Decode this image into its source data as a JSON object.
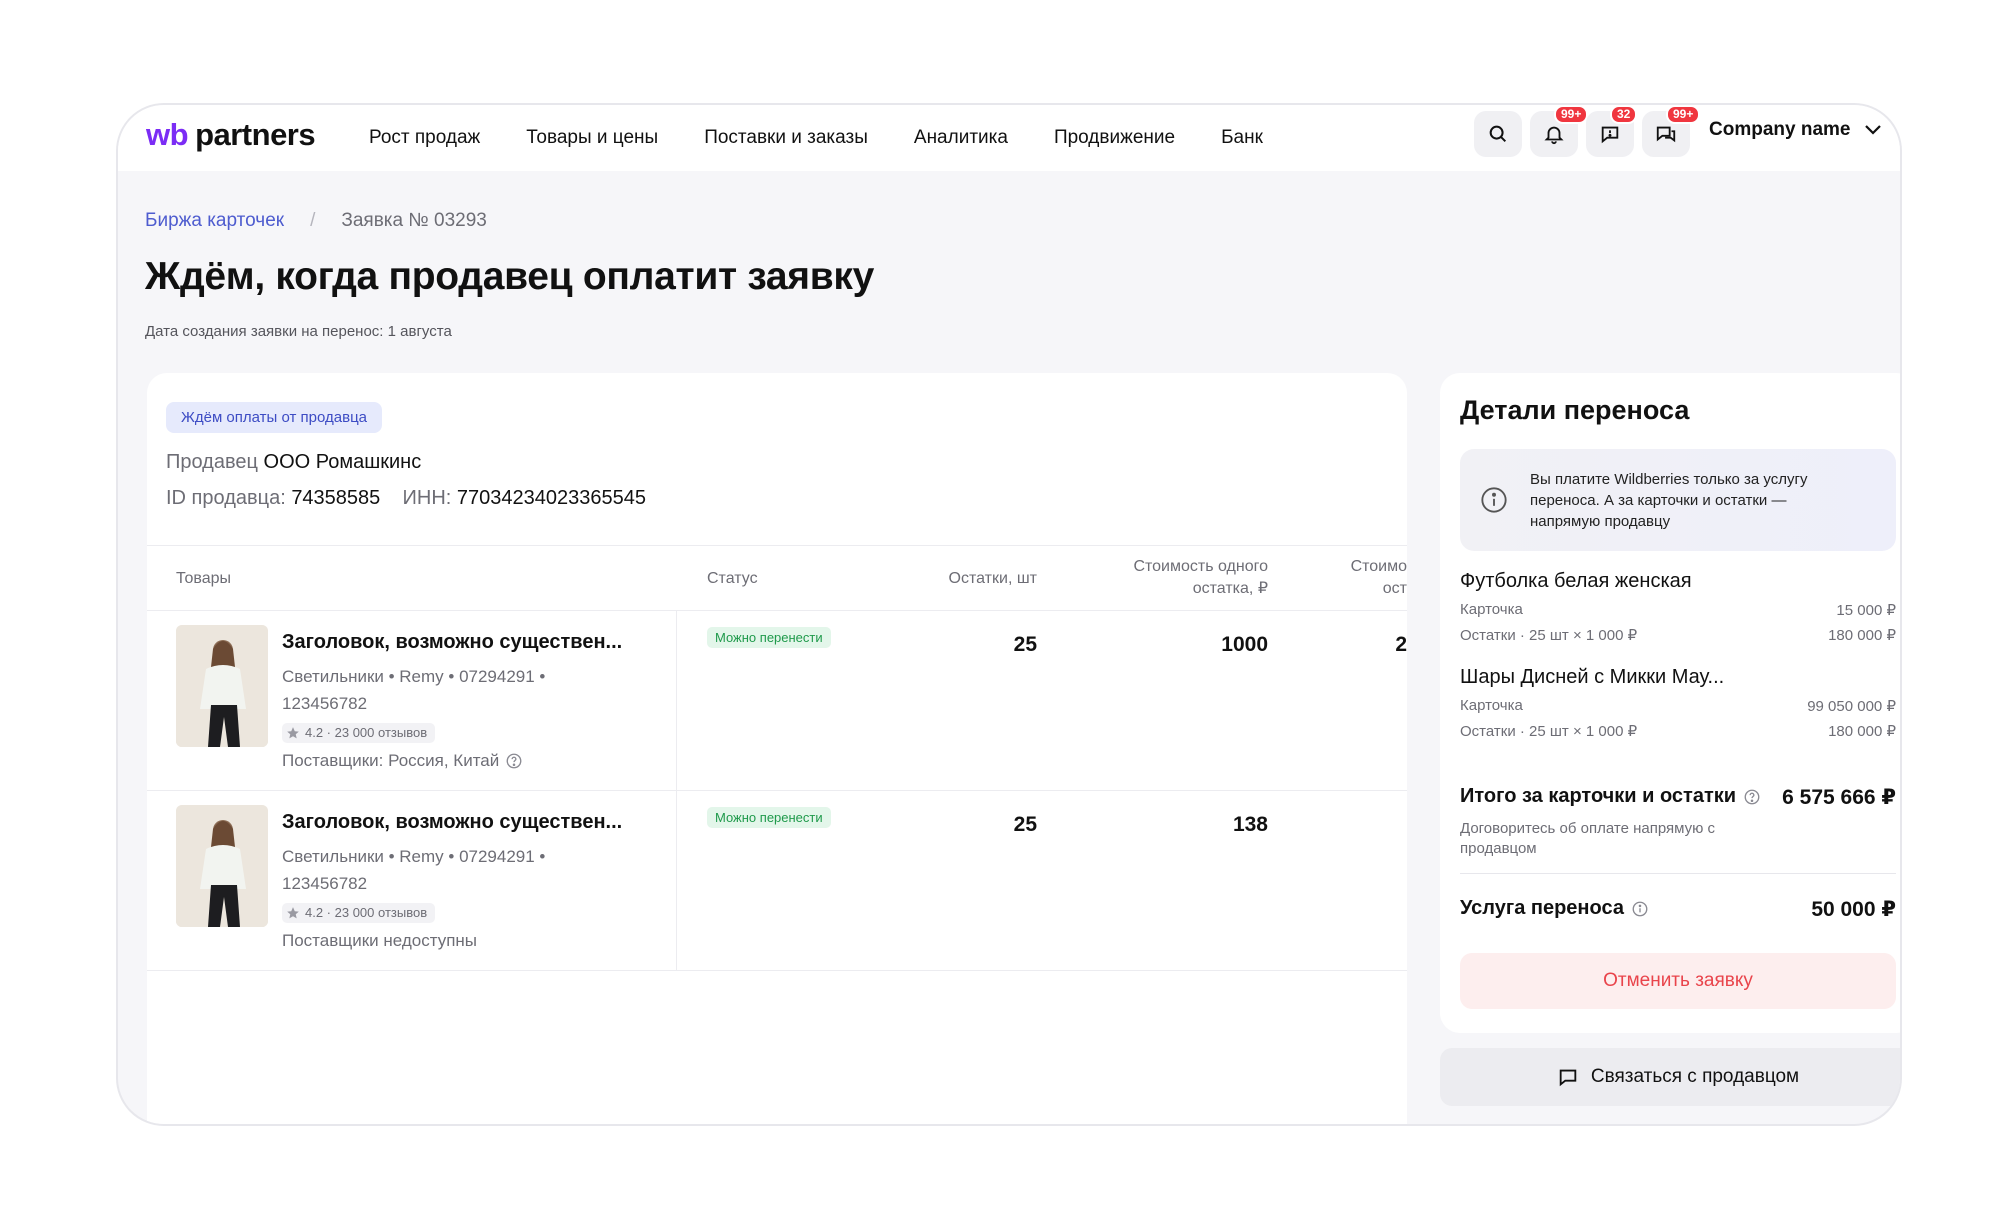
{
  "header": {
    "logo_wb": "wb",
    "logo_partners": "partners",
    "nav": [
      "Рост продаж",
      "Товары и цены",
      "Поставки и заказы",
      "Аналитика",
      "Продвижение",
      "Банк"
    ],
    "badges": {
      "notifications": "99+",
      "chat": "32",
      "messages": "99+"
    },
    "company": "Company name"
  },
  "breadcrumb": {
    "parent": "Биржа карточек",
    "separator": "/",
    "current": "Заявка № 03293"
  },
  "page": {
    "title": "Ждём, когда продавец оплатит заявку",
    "subtitle": "Дата создания заявки на перенос: 1 августа"
  },
  "request": {
    "status": "Ждём оплаты от продавца",
    "seller_label": "Продавец",
    "seller_name": "ООО Ромашкинс",
    "id_label": "ID продавца:",
    "id_value": "74358585",
    "inn_label": "ИНН:",
    "inn_value": "77034234023365545"
  },
  "table": {
    "headers": {
      "goods": "Товары",
      "status": "Статус",
      "stock": "Остатки, шт",
      "unit_cost_1": "Стоимость одного",
      "unit_cost_2": "остатка, ₽",
      "total_cost_1": "Стоимо",
      "total_cost_2": "ост"
    },
    "rows": [
      {
        "title": "Заголовок, возможно существен...",
        "meta_1": "Светильники • Remy • 07294291 •",
        "meta_2": "123456782",
        "rating": "4.2 · 23 000 отзывов",
        "suppliers": "Поставщики: Россия, Китай",
        "status": "Можно перенести",
        "stock": "25",
        "unit_cost": "1000",
        "total_partial": "2"
      },
      {
        "title": "Заголовок, возможно существен...",
        "meta_1": "Светильники • Remy • 07294291 •",
        "meta_2": "123456782",
        "rating": "4.2 · 23 000 отзывов",
        "suppliers": "Поставщики недоступны",
        "status": "Можно перенести",
        "stock": "25",
        "unit_cost": "138",
        "total_partial": ""
      }
    ]
  },
  "details": {
    "title": "Детали переноса",
    "info": "Вы платите Wildberries только за услугу переноса. А за карточки и остатки — напрямую продавцу",
    "items": [
      {
        "name": "Футболка белая женская",
        "card_label": "Карточка",
        "card_value": "15 000 ₽",
        "stock_label": "Остатки · 25 шт × 1 000 ₽",
        "stock_value": "180 000 ₽"
      },
      {
        "name": "Шары Диснeй с Микки Мау...",
        "card_label": "Карточка",
        "card_value": "99 050 000 ₽",
        "stock_label": "Остатки · 25 шт × 1 000 ₽",
        "stock_value": "180 000 ₽"
      }
    ],
    "total_label": "Итого за карточки и остатки",
    "total_value": "6 575 666 ₽",
    "total_note": "Договоритесь об оплате напрямую с продавцом",
    "service_label": "Услуга переноса",
    "service_value": "50 000 ₽",
    "cancel": "Отменить заявку",
    "contact": "Связаться с продавцом"
  },
  "colors": {
    "brand": "#7b2cf5",
    "link": "#4e5ccf",
    "danger": "#e9444b",
    "success": "#1f9a4b"
  }
}
